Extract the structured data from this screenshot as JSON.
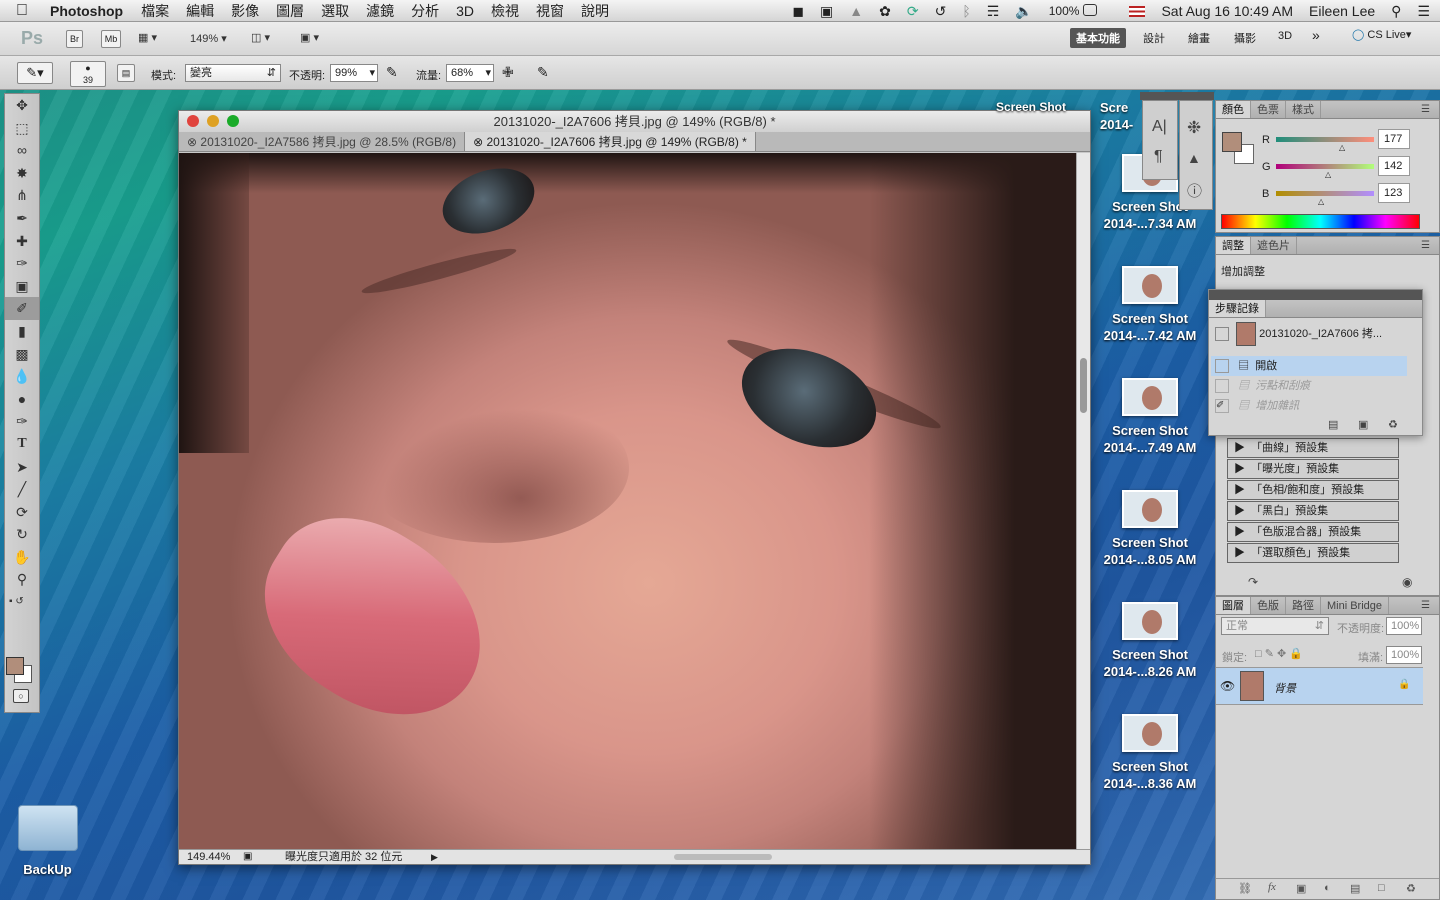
{
  "menubar": {
    "app_name": "Photoshop",
    "items": [
      "檔案",
      "編輯",
      "影像",
      "圖層",
      "選取",
      "濾鏡",
      "分析",
      "3D",
      "檢視",
      "視窗",
      "說明"
    ],
    "battery": "100%",
    "datetime": "Sat Aug 16  10:49 AM",
    "user": "Eileen Lee"
  },
  "appbar": {
    "logo": "Ps",
    "br": "Br",
    "mb": "Mb",
    "zoom": "149%",
    "workspaces": [
      "基本功能",
      "設計",
      "繪畫",
      "攝影",
      "3D"
    ],
    "more": "»",
    "cslive": "CS Live"
  },
  "options": {
    "brush_size": "39",
    "mode_label": "模式:",
    "mode_value": "變亮",
    "opacity_label": "不透明:",
    "opacity_value": "99%",
    "flow_label": "流量:",
    "flow_value": "68%"
  },
  "document": {
    "title": "20131020-_I2A7606 拷貝.jpg @ 149% (RGB/8) *",
    "tabs": [
      "20131020-_I2A7586 拷貝.jpg @ 28.5% (RGB/8)",
      "20131020-_I2A7606 拷貝.jpg @ 149% (RGB/8) *"
    ],
    "status_zoom": "149.44%",
    "status_text": "曝光度只適用於 32 位元"
  },
  "desktop": {
    "partial_top": "Screen Shot",
    "partial_label1": "Scre",
    "partial_label2": "2014-",
    "icons": [
      {
        "line1": "Screen Shot",
        "line2": "2014-...7.34 AM"
      },
      {
        "line1": "Screen Shot",
        "line2": "2014-...7.42 AM"
      },
      {
        "line1": "Screen Shot",
        "line2": "2014-...7.49 AM"
      },
      {
        "line1": "Screen Shot",
        "line2": "2014-...8.05 AM"
      },
      {
        "line1": "Screen Shot",
        "line2": "2014-...8.26 AM"
      },
      {
        "line1": "Screen Shot",
        "line2": "2014-...8.36 AM"
      }
    ],
    "folder": "BackUp"
  },
  "color_panel": {
    "tabs": [
      "顏色",
      "色票",
      "樣式"
    ],
    "r_label": "R",
    "g_label": "G",
    "b_label": "B",
    "r": "177",
    "g": "142",
    "b": "123",
    "fg_color": "#b18e7b"
  },
  "adjust_panel": {
    "tabs": [
      "調整",
      "遮色片"
    ],
    "add": "增加調整",
    "presets": [
      "「曲線」預設集",
      "「曝光度」預設集",
      "「色相/飽和度」預設集",
      "「黑白」預設集",
      "「色版混合器」預設集",
      "「選取顏色」預設集"
    ]
  },
  "history_panel": {
    "title": "步驟記錄",
    "snapshot": "20131020-_I2A7606 拷...",
    "steps": [
      "開啟",
      "污點和刮痕",
      "增加雜訊"
    ]
  },
  "layers_panel": {
    "tabs": [
      "圖層",
      "色版",
      "路徑",
      "Mini Bridge"
    ],
    "blend": "正常",
    "opacity_label": "不透明度:",
    "opacity": "100%",
    "lock_label": "鎖定:",
    "fill_label": "填滿:",
    "fill": "100%",
    "layer_name": "背景"
  }
}
